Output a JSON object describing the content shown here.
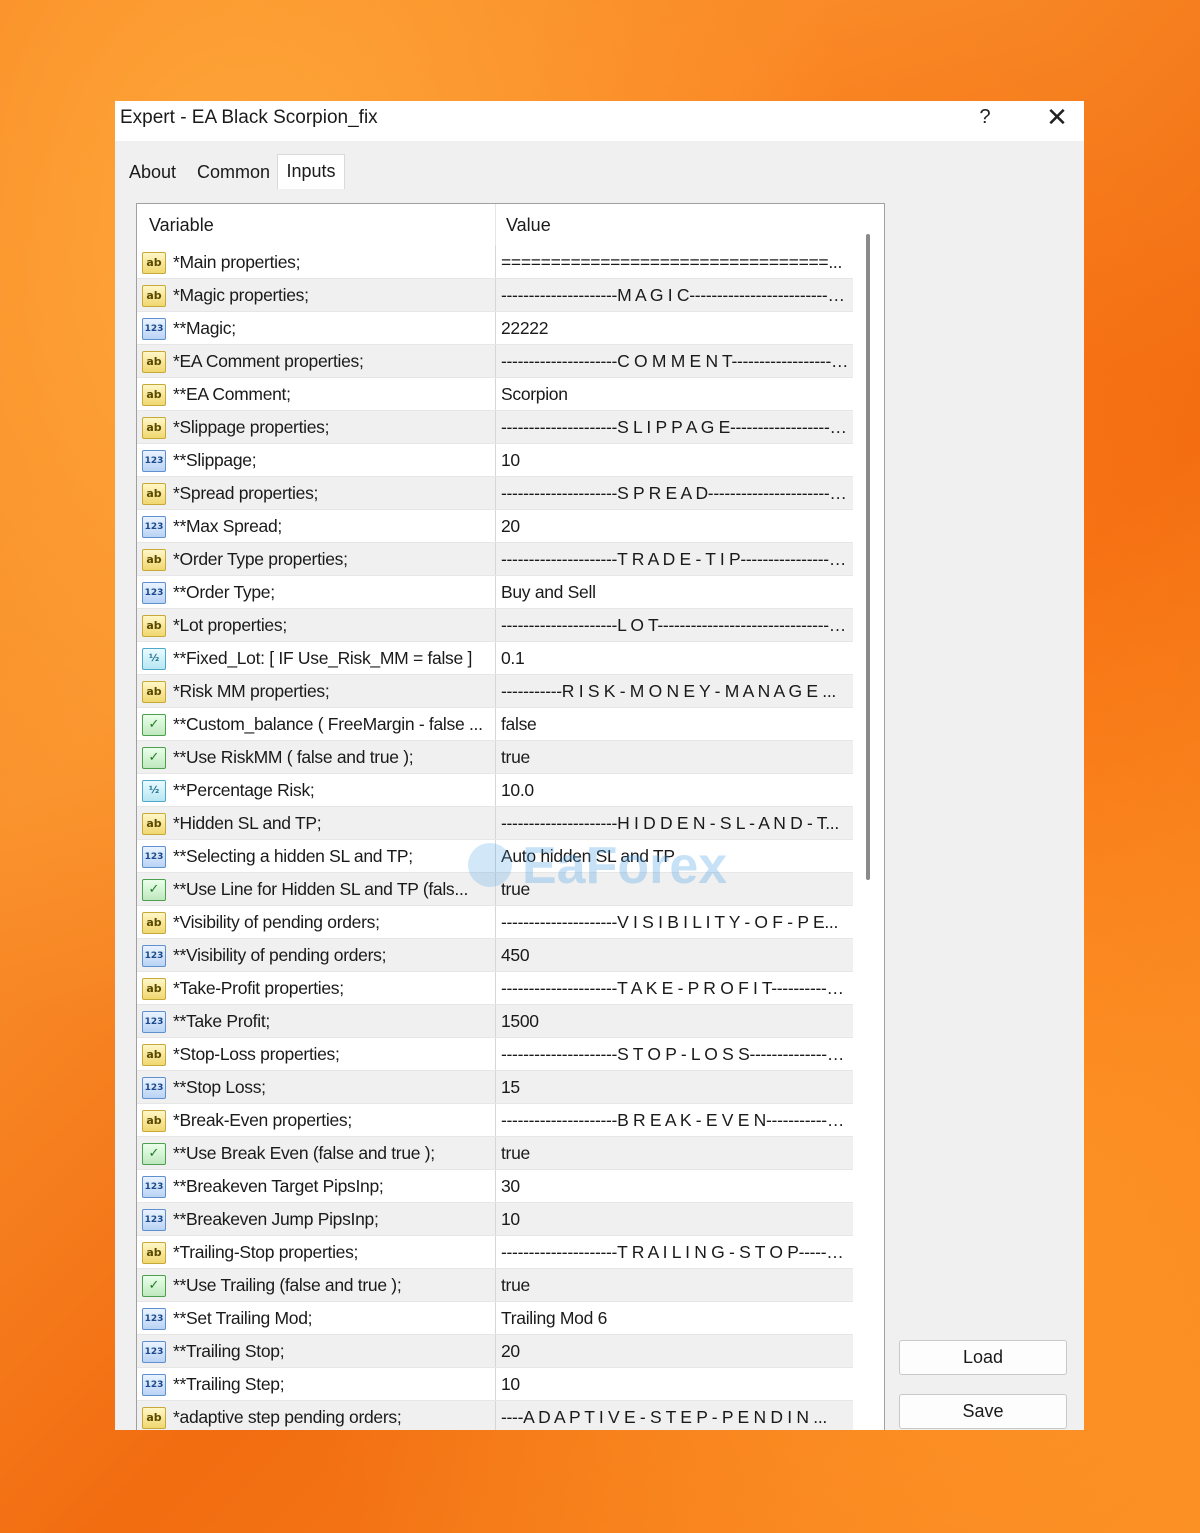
{
  "window": {
    "title": "Expert - EA Black Scorpion_fix",
    "help_label": "?",
    "close_label": "✕"
  },
  "tabs": [
    {
      "label": "About"
    },
    {
      "label": "Common"
    },
    {
      "label": "Inputs",
      "active": true
    }
  ],
  "table": {
    "columns": {
      "variable": "Variable",
      "value": "Value"
    },
    "rows": [
      {
        "type": "string",
        "variable": "*Main properties;",
        "value": "=================================..."
      },
      {
        "type": "string",
        "variable": "*Magic properties;",
        "value": "---------------------M A G I C-------------------------------..."
      },
      {
        "type": "int",
        "variable": "**Magic;",
        "value": "22222"
      },
      {
        "type": "string",
        "variable": "*EA Comment properties;",
        "value": "---------------------C O M M E N T--------------------..."
      },
      {
        "type": "string",
        "variable": "**EA Comment;",
        "value": "Scorpion"
      },
      {
        "type": "string",
        "variable": "*Slippage properties;",
        "value": "---------------------S L I P P A G E------------------------..."
      },
      {
        "type": "int",
        "variable": "**Slippage;",
        "value": "10"
      },
      {
        "type": "string",
        "variable": "*Spread properties;",
        "value": "---------------------S P R E A D-----------------------------..."
      },
      {
        "type": "int",
        "variable": "**Max Spread;",
        "value": "20"
      },
      {
        "type": "string",
        "variable": "*Order Type properties;",
        "value": "---------------------T R A D E - T I P--------------------..."
      },
      {
        "type": "int",
        "variable": "**Order Type;",
        "value": "Buy and Sell"
      },
      {
        "type": "string",
        "variable": "*Lot properties;",
        "value": "---------------------L O T-------------------------------------..."
      },
      {
        "type": "double",
        "variable": "**Fixed_Lot: [ IF  Use_Risk_MM = false ]",
        "value": "0.1"
      },
      {
        "type": "string",
        "variable": "*Risk MM properties;",
        "value": "-----------R I S K - M O N E Y - M A N A G E ..."
      },
      {
        "type": "bool",
        "variable": "**Custom_balance ( FreeMargin - false ...",
        "value": "false"
      },
      {
        "type": "bool",
        "variable": "**Use RiskMM ( false and true );",
        "value": "true"
      },
      {
        "type": "double",
        "variable": "**Percentage Risk;",
        "value": "10.0"
      },
      {
        "type": "string",
        "variable": "*Hidden SL and TP;",
        "value": "---------------------H I D D E N - S L - A N D - T..."
      },
      {
        "type": "int",
        "variable": "**Selecting a hidden SL and TP;",
        "value": "Auto hidden SL and TP"
      },
      {
        "type": "bool",
        "variable": "**Use Line for Hidden SL and TP (fals...",
        "value": "true"
      },
      {
        "type": "string",
        "variable": "*Visibility of pending orders;",
        "value": "---------------------V I S I B I L I T Y - O F - P E..."
      },
      {
        "type": "int",
        "variable": "**Visibility of pending orders;",
        "value": "450"
      },
      {
        "type": "string",
        "variable": "*Take-Profit properties;",
        "value": "---------------------T A K E - P R O F I T-------------..."
      },
      {
        "type": "int",
        "variable": "**Take Profit;",
        "value": "1500"
      },
      {
        "type": "string",
        "variable": "*Stop-Loss properties;",
        "value": "---------------------S T O P - L O S S--------------------..."
      },
      {
        "type": "int",
        "variable": "**Stop Loss;",
        "value": "15"
      },
      {
        "type": "string",
        "variable": "*Break-Even properties;",
        "value": "---------------------B R E A K - E V E N-----------------..."
      },
      {
        "type": "bool",
        "variable": "**Use Break Even (false and true );",
        "value": "true"
      },
      {
        "type": "int",
        "variable": "**Breakeven Target PipsInp;",
        "value": "30"
      },
      {
        "type": "int",
        "variable": "**Breakeven Jump PipsInp;",
        "value": "10"
      },
      {
        "type": "string",
        "variable": "*Trailing-Stop properties;",
        "value": "---------------------T R A I L I N G - S T O P-------..."
      },
      {
        "type": "bool",
        "variable": "**Use Trailing (false and true );",
        "value": "true"
      },
      {
        "type": "int",
        "variable": "**Set Trailing Mod;",
        "value": "Trailing Mod 6"
      },
      {
        "type": "int",
        "variable": "**Trailing Stop;",
        "value": "20"
      },
      {
        "type": "int",
        "variable": "**Trailing Step;",
        "value": "10"
      },
      {
        "type": "string",
        "variable": "*adaptive step pending orders;",
        "value": "----A D A P T I V E - S T E P - P E N D I N ..."
      }
    ]
  },
  "icons": {
    "string": {
      "glyph": "ab",
      "name": "string-type-icon"
    },
    "int": {
      "glyph": "123",
      "name": "integer-type-icon"
    },
    "double": {
      "glyph": "½",
      "name": "double-type-icon"
    },
    "bool": {
      "glyph": "✓",
      "name": "boolean-type-icon"
    }
  },
  "buttons": {
    "load_label": "Load",
    "save_label": "Save"
  },
  "watermark": {
    "text": "EaForex"
  }
}
